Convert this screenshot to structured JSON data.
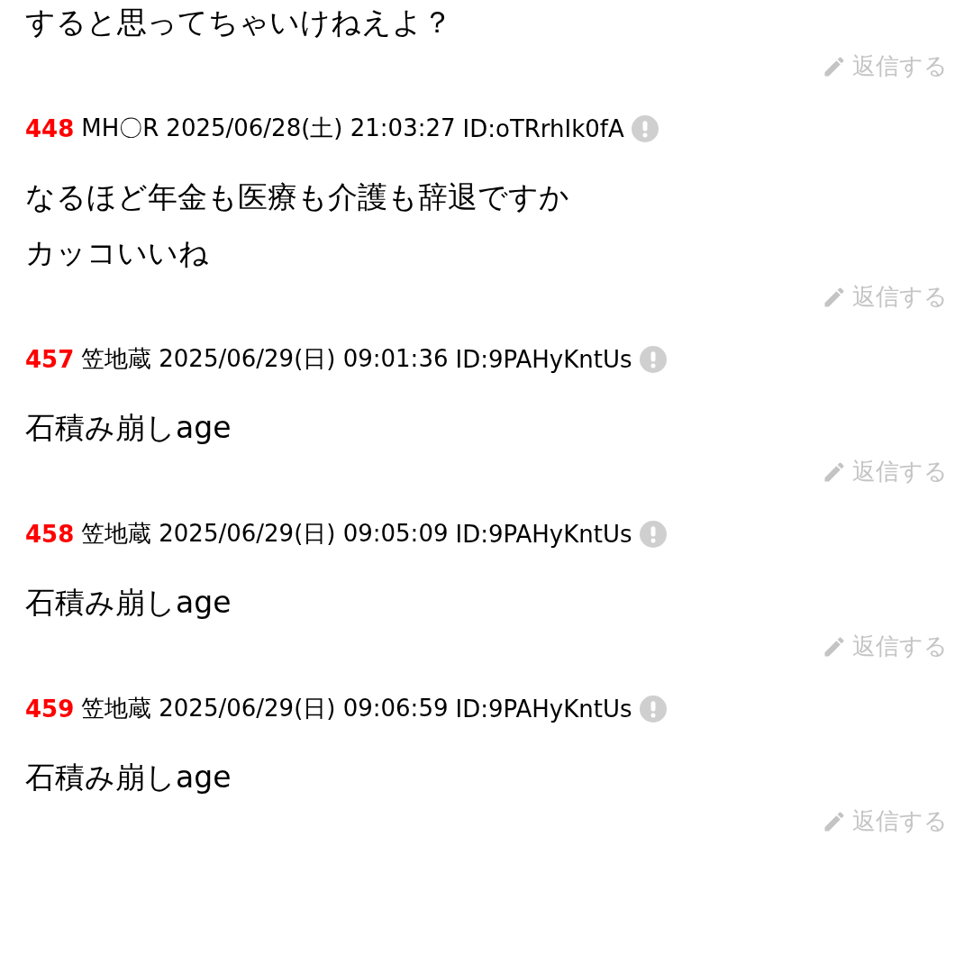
{
  "previous_post": {
    "body": [
      "すると思ってちゃいけねえよ？"
    ],
    "reply_label": "返信する"
  },
  "posts": [
    {
      "number": "448",
      "name": "MH〇R",
      "datetime": "2025/06/28(土) 21:03:27",
      "id": "ID:oTRrhIk0fA",
      "body": [
        "なるほど年金も医療も介護も辞退ですか",
        "カッコいいね"
      ],
      "reply_label": "返信する"
    },
    {
      "number": "457",
      "name": "笠地蔵",
      "datetime": "2025/06/29(日) 09:01:36",
      "id": "ID:9PAHyKntUs",
      "body": [
        "石積み崩しage"
      ],
      "reply_label": "返信する"
    },
    {
      "number": "458",
      "name": "笠地蔵",
      "datetime": "2025/06/29(日) 09:05:09",
      "id": "ID:9PAHyKntUs",
      "body": [
        "石積み崩しage"
      ],
      "reply_label": "返信する"
    },
    {
      "number": "459",
      "name": "笠地蔵",
      "datetime": "2025/06/29(日) 09:06:59",
      "id": "ID:9PAHyKntUs",
      "body": [
        "石積み崩しage"
      ],
      "reply_label": "返信する"
    }
  ]
}
